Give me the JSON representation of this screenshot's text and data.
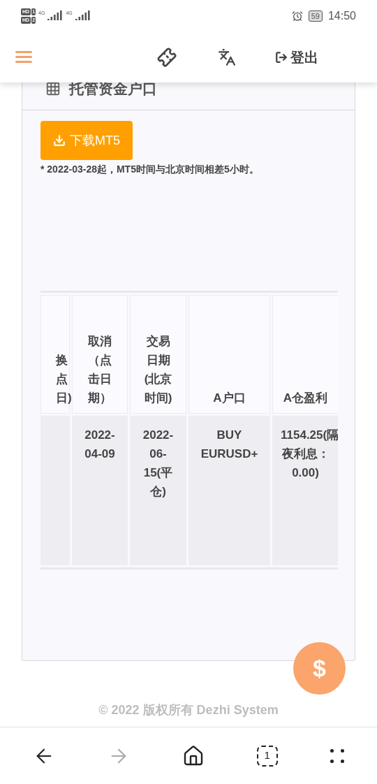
{
  "status_bar": {
    "sims": [
      {
        "hd": "HD",
        "slot": "1",
        "net": "4G"
      },
      {
        "hd": "HD",
        "slot": "2",
        "net": "4G"
      }
    ],
    "battery": "59",
    "time": "14:50"
  },
  "navbar": {
    "logout": "登出"
  },
  "card": {
    "title": "托管资金户口",
    "download_button": "下载MT5",
    "note": "* 2022-03-28起，MT5时间与北京时间相差5小时。"
  },
  "table": {
    "columns": [
      "换点日)",
      "取消（点击日期）",
      "交易日期(北京时间)",
      "A户口",
      "A仓盈利"
    ],
    "rows": [
      [
        "",
        "2022-04-09",
        "2022-06-15(平仓)",
        "BUY EURUSD+",
        "1154.25(隔夜利息：0.00)"
      ]
    ]
  },
  "fab": "$",
  "footer": "© 2022 版权所有 Dezhi System",
  "browser_bar": {
    "tab_count": "1"
  }
}
